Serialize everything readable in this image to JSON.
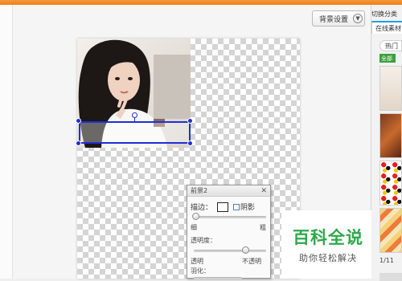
{
  "window": {
    "title": ""
  },
  "toolbar": {
    "background_settings_label": "背景设置"
  },
  "foreground_panel": {
    "title": "前景2",
    "stroke_label": "描边：",
    "shadow_label": "阴影",
    "thin_label": "细",
    "thick_label": "粗",
    "opacity_label": "透明度：",
    "transparent_label": "透明",
    "opaque_label": "不透明",
    "feather_label": "羽化："
  },
  "watermark": {
    "brand": "百科全说",
    "slogan": "助你轻松解决"
  },
  "sidebar": {
    "switch_label": "切换分类",
    "tab_online": "在线素材",
    "hot_label": "热门",
    "all_label": "全部",
    "page_indicator": "1/11"
  },
  "colors": {
    "titlebar": "#f07d17",
    "selection": "#1f2fd6",
    "brand_green": "#2ea84b",
    "tab_accent": "#1aa1e4"
  }
}
